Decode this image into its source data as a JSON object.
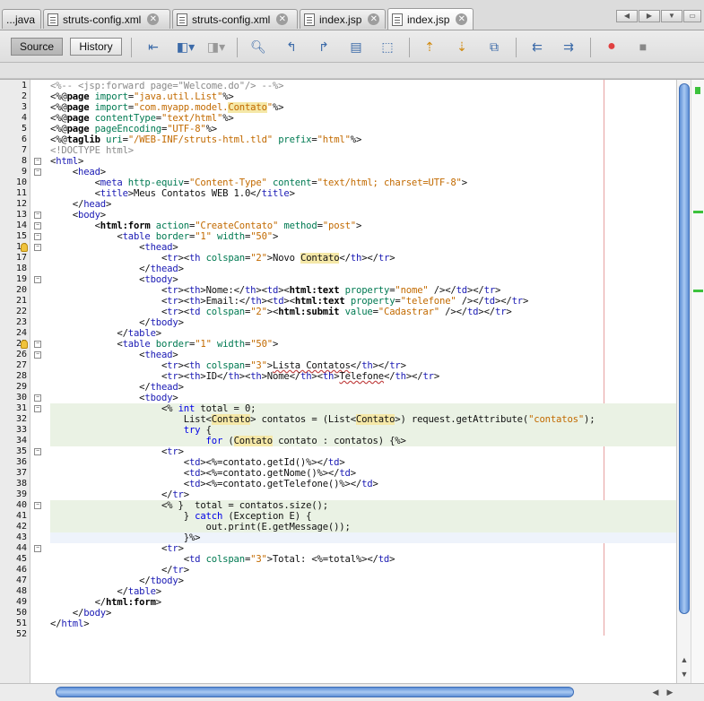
{
  "tabs": [
    {
      "label": "...java",
      "active": false,
      "icon": "java-file-icon"
    },
    {
      "label": "struts-config.xml",
      "active": false,
      "icon": "xml-file-icon"
    },
    {
      "label": "struts-config.xml",
      "active": false,
      "icon": "xml-file-icon"
    },
    {
      "label": "index.jsp",
      "active": false,
      "icon": "jsp-file-icon"
    },
    {
      "label": "index.jsp",
      "active": true,
      "icon": "jsp-file-icon"
    }
  ],
  "toolbar": {
    "source_label": "Source",
    "history_label": "History"
  },
  "editor": {
    "lines": [
      {
        "n": 1,
        "text": "<%-- <jsp:forward page=\"Welcome.do\"/> --%>"
      },
      {
        "n": 2,
        "text": "<%@page import=\"java.util.List\"%>"
      },
      {
        "n": 3,
        "text": "<%@page import=\"com.myapp.model.Contato\"%>"
      },
      {
        "n": 4,
        "text": "<%@page contentType=\"text/html\"%>"
      },
      {
        "n": 5,
        "text": "<%@page pageEncoding=\"UTF-8\"%>"
      },
      {
        "n": 6,
        "text": "<%@taglib uri=\"/WEB-INF/struts-html.tld\" prefix=\"html\"%>"
      },
      {
        "n": 7,
        "text": "<!DOCTYPE html>"
      },
      {
        "n": 8,
        "text": "<html>"
      },
      {
        "n": 9,
        "text": "    <head>"
      },
      {
        "n": 10,
        "text": "        <meta http-equiv=\"Content-Type\" content=\"text/html; charset=UTF-8\">"
      },
      {
        "n": 11,
        "text": "        <title>Meus Contatos WEB 1.0</title>"
      },
      {
        "n": 12,
        "text": "    </head>"
      },
      {
        "n": 13,
        "text": "    <body>"
      },
      {
        "n": 14,
        "text": "        <html:form action=\"CreateContato\" method=\"post\">"
      },
      {
        "n": 15,
        "text": "            <table border=\"1\" width=\"50\">"
      },
      {
        "n": 16,
        "text": "                <thead>"
      },
      {
        "n": 17,
        "text": "                    <tr><th colspan=\"2\">Novo Contato</th></tr>"
      },
      {
        "n": 18,
        "text": "                </thead>"
      },
      {
        "n": 19,
        "text": "                <tbody>"
      },
      {
        "n": 20,
        "text": "                    <tr><th>Nome:</th><td><html:text property=\"nome\" /></td></tr>"
      },
      {
        "n": 21,
        "text": "                    <tr><th>Email:</th><td><html:text property=\"telefone\" /></td></tr>"
      },
      {
        "n": 22,
        "text": "                    <tr><td colspan=\"2\"><html:submit value=\"Cadastrar\" /></td></tr>"
      },
      {
        "n": 23,
        "text": "                </tbody>"
      },
      {
        "n": 24,
        "text": "            </table>"
      },
      {
        "n": 25,
        "text": "            <table border=\"1\" width=\"50\">"
      },
      {
        "n": 26,
        "text": "                <thead>"
      },
      {
        "n": 27,
        "text": "                    <tr><th colspan=\"3\">Lista Contatos</th></tr>"
      },
      {
        "n": 28,
        "text": "                    <tr><th>ID</th><th>Nome</th><th>Telefone</th></tr>"
      },
      {
        "n": 29,
        "text": "                </thead>"
      },
      {
        "n": 30,
        "text": "                <tbody>"
      },
      {
        "n": 31,
        "text": "                    <% int total = 0;"
      },
      {
        "n": 32,
        "text": "                        List<Contato> contatos = (List<Contato>) request.getAttribute(\"contatos\");"
      },
      {
        "n": 33,
        "text": "                        try {"
      },
      {
        "n": 34,
        "text": "                            for (Contato contato : contatos) {%>"
      },
      {
        "n": 35,
        "text": "                    <tr>"
      },
      {
        "n": 36,
        "text": "                        <td><%=contato.getId()%></td>"
      },
      {
        "n": 37,
        "text": "                        <td><%=contato.getNome()%></td>"
      },
      {
        "n": 38,
        "text": "                        <td><%=contato.getTelefone()%></td>"
      },
      {
        "n": 39,
        "text": "                    </tr>"
      },
      {
        "n": 40,
        "text": "                    <% }  total = contatos.size();"
      },
      {
        "n": 41,
        "text": "                        } catch (Exception E) {"
      },
      {
        "n": 42,
        "text": "                            out.print(E.getMessage());"
      },
      {
        "n": 43,
        "text": "                        }%>"
      },
      {
        "n": 44,
        "text": "                    <tr>"
      },
      {
        "n": 45,
        "text": "                        <td colspan=\"3\">Total: <%=total%></td>"
      },
      {
        "n": 46,
        "text": "                    </tr>"
      },
      {
        "n": 47,
        "text": "                </tbody>"
      },
      {
        "n": 48,
        "text": "            </table>"
      },
      {
        "n": 49,
        "text": "        </html:form>"
      },
      {
        "n": 50,
        "text": "    </body>"
      },
      {
        "n": 51,
        "text": "</html>"
      },
      {
        "n": 52,
        "text": ""
      }
    ]
  },
  "colors": {
    "comment": "#8a8a8a",
    "tag": "#1a1ab4",
    "attribute": "#007a52",
    "string": "#c26a00",
    "keyword": "#0000e6",
    "java_block_bg": "#eaf2e4",
    "margin_line": "#e6a0a0",
    "scroll_thumb": "#5e8fd6"
  }
}
